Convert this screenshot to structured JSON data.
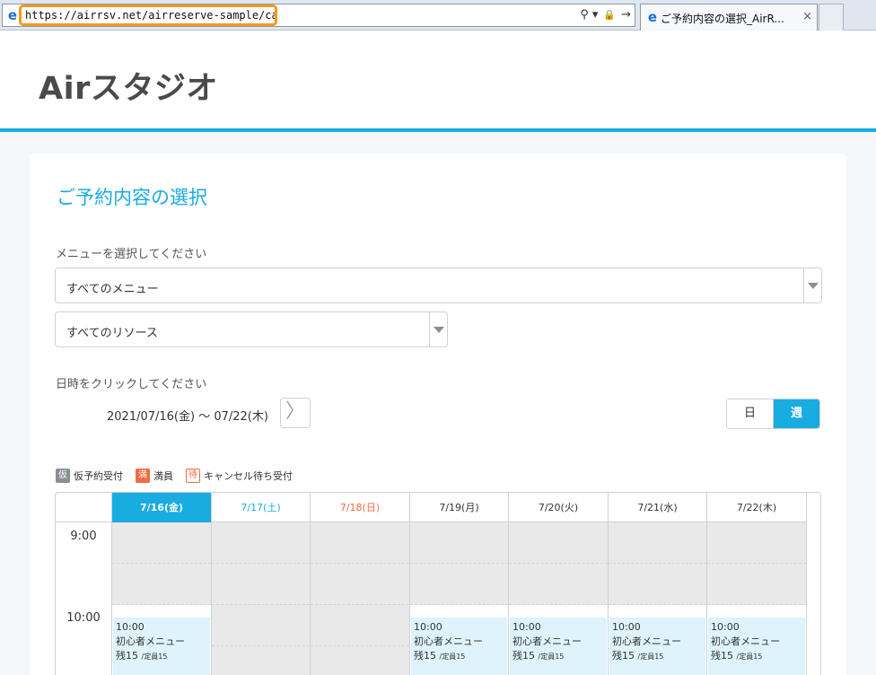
{
  "browser": {
    "url": "https://airrsv.net/airreserve-sample/calendar",
    "tab_title": "ご予約内容の選択_AirR...",
    "ie_glyph": "e",
    "search_glyph": "⚲ ▾",
    "lock_glyph": "🔒",
    "go_glyph": "→",
    "close_glyph": "×"
  },
  "site": {
    "logo": "Airスタジオ"
  },
  "page": {
    "title": "ご予約内容の選択",
    "menu_label": "メニューを選択してください",
    "menu_select": "すべてのメニュー",
    "resource_select": "すべてのリソース",
    "datetime_label": "日時をクリックしてください",
    "date_range": "2021/07/16(金) 〜 07/22(木)",
    "next_glyph": "〉",
    "view_day": "日",
    "view_week": "週"
  },
  "legend": [
    {
      "badge": "仮",
      "text": "仮予約受付"
    },
    {
      "badge": "満",
      "text": "満員"
    },
    {
      "badge": "待",
      "text": "キャンセル待ち受付"
    }
  ],
  "calendar": {
    "days": [
      "7/16(金)",
      "7/17(土)",
      "7/18(日)",
      "7/19(月)",
      "7/20(火)",
      "7/21(水)",
      "7/22(木)"
    ],
    "times": [
      "9:00",
      "10:00"
    ],
    "slot_time": "10:00",
    "slot_menu": "初心者メニュー",
    "slot_rest": "残15",
    "slot_capacity": "/定員15"
  },
  "colors": {
    "accent": "#19ace1",
    "orange": "#ef6b40",
    "url_highlight": "#f39a1c"
  }
}
